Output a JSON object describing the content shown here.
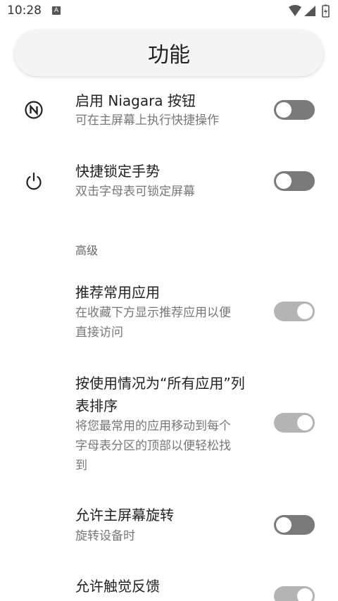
{
  "status_bar": {
    "time": "10:28",
    "badge": "A"
  },
  "header": {
    "title": "功能"
  },
  "settings": [
    {
      "title": "启用 Niagara 按钮",
      "subtitle": "可在主屏幕上执行快捷操作",
      "icon": "niagara-n-icon",
      "enabled": false
    },
    {
      "title": "快捷锁定手势",
      "subtitle": "双击字母表可锁定屏幕",
      "icon": "power-icon",
      "enabled": false
    }
  ],
  "advanced": {
    "label": "高级",
    "items": [
      {
        "title": "推荐常用应用",
        "subtitle_lines": [
          "在收藏下方显示推荐应用以便",
          "直接访问"
        ],
        "enabled": true
      },
      {
        "title_lines": [
          "按使用情况为“所有应用”列",
          "表排序"
        ],
        "subtitle_lines": [
          "将您最常用的应用移动到每个",
          "字母表分区的顶部以便轻松找",
          "到"
        ],
        "enabled": true
      },
      {
        "title": "允许主屏幕旋转",
        "subtitle": "旋转设备时",
        "enabled": false
      },
      {
        "title": "允许触觉反馈",
        "enabled": true
      }
    ]
  },
  "colors": {
    "toggle_off": "#7a7a7a",
    "toggle_on": "#b4b4b4",
    "pill": "#f4f4f4"
  }
}
